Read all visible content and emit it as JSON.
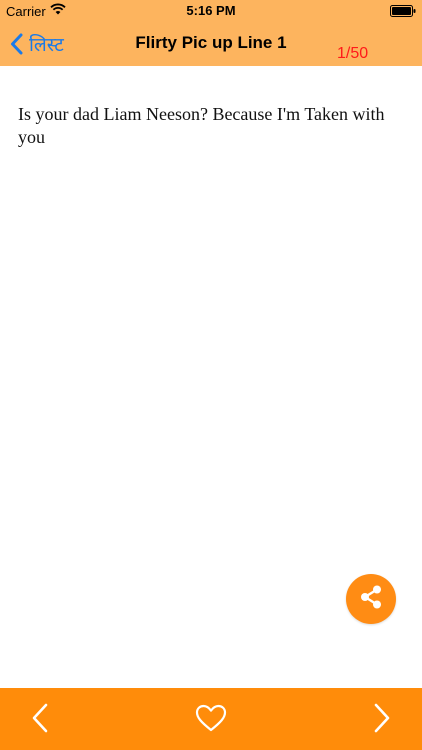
{
  "status_bar": {
    "carrier": "Carrier",
    "time": "5:16 PM"
  },
  "nav": {
    "back_label": "लिस्ट",
    "title": "Flirty Pic up Line 1",
    "counter": "1/50"
  },
  "content": {
    "text": "Is your dad Liam Neeson? Because I'm Taken with you"
  },
  "icons": {
    "share": "share-icon",
    "prev": "chevron-left-icon",
    "favorite": "heart-icon",
    "next": "chevron-right-icon"
  },
  "colors": {
    "nav_bar": "#fdb45e",
    "bottom_bar": "#ff8c0a",
    "share_button": "#ff8c14",
    "back_link": "#1a7ae8",
    "counter": "#ff1a1a"
  }
}
